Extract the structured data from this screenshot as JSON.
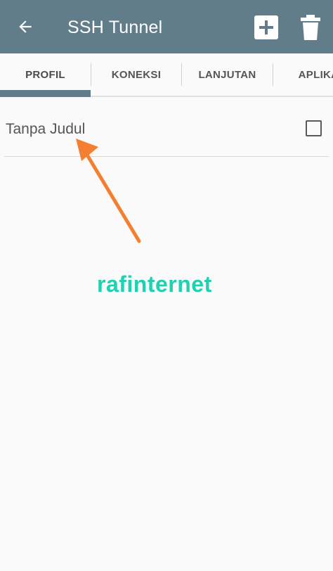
{
  "appbar": {
    "title": "SSH Tunnel",
    "background_color": "#617d8a",
    "icons": {
      "back": "arrow-back-icon",
      "add": "add-box-icon",
      "delete": "trash-icon"
    }
  },
  "tabs": [
    {
      "label": "PROFIL",
      "active": true
    },
    {
      "label": "KONEKSI",
      "active": false
    },
    {
      "label": "LANJUTAN",
      "active": false
    },
    {
      "label": "APLIKA",
      "active": false
    }
  ],
  "profile_list": {
    "items": [
      {
        "label": "Tanpa Judul",
        "checked": false
      }
    ]
  },
  "annotation": {
    "watermark_text": "rafinternet",
    "watermark_color": "#1fd1b0",
    "arrow_color": "#f57f30"
  }
}
